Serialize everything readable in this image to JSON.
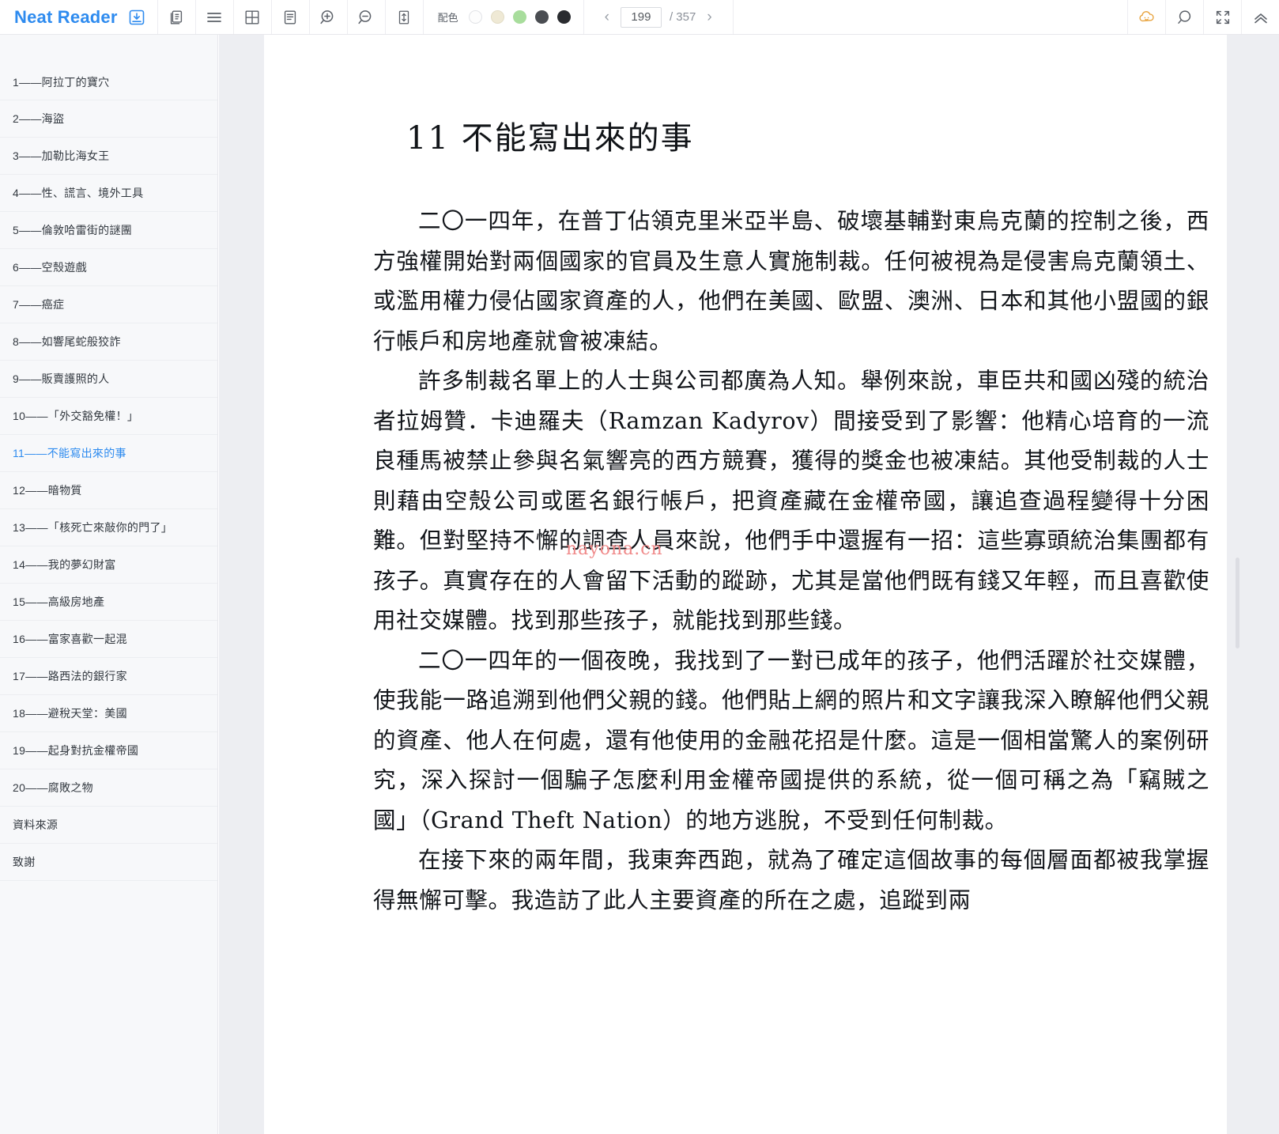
{
  "app": {
    "brand": "Neat Reader",
    "brand_icon": "save-book-icon"
  },
  "toolbar": {
    "buttons": [
      {
        "name": "two-page-view-icon",
        "label": "two-page-view"
      },
      {
        "name": "list-view-icon",
        "label": "list-view"
      },
      {
        "name": "grid-view-icon",
        "label": "grid-view"
      },
      {
        "name": "single-column-icon",
        "label": "single-column"
      },
      {
        "name": "zoom-in-icon",
        "label": "zoom-in"
      },
      {
        "name": "zoom-out-icon",
        "label": "zoom-out"
      },
      {
        "name": "line-height-icon",
        "label": "line-height"
      }
    ],
    "color_label": "配色",
    "swatches": [
      {
        "name": "theme-white",
        "color": "#fdfdfd",
        "border": "#e2e3e7",
        "selected": false
      },
      {
        "name": "theme-sepia",
        "color": "#efe9d5",
        "border": "#e2dcc6",
        "selected": false
      },
      {
        "name": "theme-green",
        "color": "#a8dd9c",
        "border": "#a8dd9c",
        "selected": false
      },
      {
        "name": "theme-dark-gray",
        "color": "#4a4d52",
        "border": "#4a4d52",
        "selected": false
      },
      {
        "name": "theme-black",
        "color": "#2a2c30",
        "border": "#2a2c30",
        "selected": false
      }
    ],
    "pager": {
      "prev": "‹",
      "next": "›",
      "current_page": "199",
      "total": "/ 357"
    },
    "right_buttons": [
      {
        "name": "cloud-sync-icon",
        "label": "cloud-sync",
        "color": "#e8a33d"
      },
      {
        "name": "search-icon",
        "label": "search"
      },
      {
        "name": "fullscreen-icon",
        "label": "fullscreen"
      },
      {
        "name": "collapse-toolbar-icon",
        "label": "collapse-toolbar"
      }
    ]
  },
  "sidebar": {
    "items": [
      {
        "label": "1——阿拉丁的寶穴",
        "active": false
      },
      {
        "label": "2——海盜",
        "active": false
      },
      {
        "label": "3——加勒比海女王",
        "active": false
      },
      {
        "label": "4——性、謊言、境外工具",
        "active": false
      },
      {
        "label": "5——倫敦哈雷街的謎團",
        "active": false
      },
      {
        "label": "6——空殼遊戲",
        "active": false
      },
      {
        "label": "7——癌症",
        "active": false
      },
      {
        "label": "8——如響尾蛇般狡詐",
        "active": false
      },
      {
        "label": "9——販賣護照的人",
        "active": false
      },
      {
        "label": "10——「外交豁免權！」",
        "active": false
      },
      {
        "label": "11——不能寫出來的事",
        "active": true
      },
      {
        "label": "12——暗物質",
        "active": false
      },
      {
        "label": "13——「核死亡來敲你的門了」",
        "active": false
      },
      {
        "label": "14——我的夢幻財富",
        "active": false
      },
      {
        "label": "15——高級房地產",
        "active": false
      },
      {
        "label": "16——富家喜歡一起混",
        "active": false
      },
      {
        "label": "17——路西法的銀行家",
        "active": false
      },
      {
        "label": "18——避稅天堂：美國",
        "active": false
      },
      {
        "label": "19——起身對抗金權帝國",
        "active": false
      },
      {
        "label": "20——腐敗之物",
        "active": false
      },
      {
        "label": "資料來源",
        "active": false
      },
      {
        "label": "致謝",
        "active": false
      }
    ]
  },
  "content": {
    "chapter_title": "11 不能寫出來的事",
    "paragraphs": [
      "二〇一四年，在普丁佔領克里米亞半島、破壞基輔對東烏克蘭的控制之後，西方強權開始對兩個國家的官員及生意人實施制裁。任何被視為是侵害烏克蘭領土、或濫用權力侵佔國家資產的人，他們在美國、歐盟、澳洲、日本和其他小盟國的銀行帳戶和房地產就會被凍結。",
      "許多制裁名單上的人士與公司都廣為人知。舉例來說，車臣共和國凶殘的統治者拉姆贊．卡迪羅夫（Ramzan Kadyrov）間接受到了影響：他精心培育的一流良種馬被禁止參與名氣響亮的西方競賽，獲得的獎金也被凍結。其他受制裁的人士則藉由空殼公司或匿名銀行帳戶，把資產藏在金權帝國，讓追查過程變得十分困難。但對堅持不懈的調查人員來說，他們手中還握有一招：這些寡頭統治集團都有孩子。真實存在的人會留下活動的蹤跡，尤其是當他們既有錢又年輕，而且喜歡使用社交媒體。找到那些孩子，就能找到那些錢。",
      "二〇一四年的一個夜晚，我找到了一對已成年的孩子，他們活躍於社交媒體，使我能一路追溯到他們父親的錢。他們貼上網的照片和文字讓我深入瞭解他們父親的資產、他人在何處，還有他使用的金融花招是什麼。這是一個相當驚人的案例研究，深入探討一個騙子怎麼利用金權帝國提供的系統，從一個可稱之為「竊賊之國」（Grand Theft Nation）的地方逃脫，不受到任何制裁。",
      "在接下來的兩年間，我東奔西跑，就為了確定這個故事的每個層面都被我掌握得無懈可擊。我造訪了此人主要資產的所在之處，追蹤到兩"
    ],
    "watermark": "nayona.cn"
  },
  "colors": {
    "brand": "#2e8bef",
    "active_toc": "#2e8bef",
    "sidebar_bg": "#f7f8fa",
    "gutter_bg": "#edeef2",
    "watermark": "#f08a8a"
  }
}
